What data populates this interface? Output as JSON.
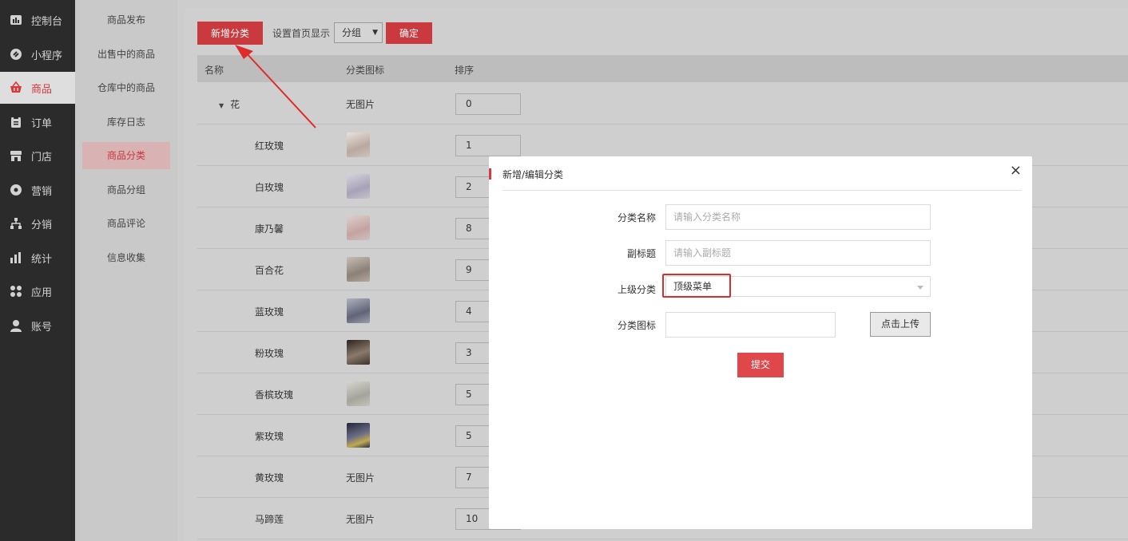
{
  "nav": {
    "items": [
      {
        "label": "控制台",
        "icon": "dashboard-icon"
      },
      {
        "label": "小程序",
        "icon": "link-icon"
      },
      {
        "label": "商品",
        "icon": "basket-icon",
        "active": true
      },
      {
        "label": "订单",
        "icon": "clipboard-icon"
      },
      {
        "label": "门店",
        "icon": "store-icon"
      },
      {
        "label": "营销",
        "icon": "gear-icon"
      },
      {
        "label": "分销",
        "icon": "hierarchy-icon"
      },
      {
        "label": "统计",
        "icon": "bar-chart-icon"
      },
      {
        "label": "应用",
        "icon": "apps-icon"
      },
      {
        "label": "账号",
        "icon": "user-icon"
      }
    ]
  },
  "subnav": {
    "items": [
      {
        "label": "商品发布"
      },
      {
        "label": "出售中的商品"
      },
      {
        "label": "仓库中的商品"
      },
      {
        "label": "库存日志"
      },
      {
        "label": "商品分类",
        "active": true
      },
      {
        "label": "商品分组"
      },
      {
        "label": "商品评论"
      },
      {
        "label": "信息收集"
      }
    ]
  },
  "toolbar": {
    "add_category_label": "新增分类",
    "homepage_display_label": "设置首页显示",
    "display_select_value": "分组",
    "confirm_label": "确定"
  },
  "table": {
    "columns": [
      "名称",
      "分类图标",
      "排序"
    ],
    "rows": [
      {
        "name": "花",
        "icon_text": "无图片",
        "sort": "0",
        "parent": true
      },
      {
        "name": "红玫瑰",
        "icon_text": "",
        "sort": "1",
        "thumb_color": "#cfc6c0"
      },
      {
        "name": "白玫瑰",
        "icon_text": "",
        "sort": "2",
        "thumb_color": "#c4c0cc"
      },
      {
        "name": "康乃馨",
        "icon_text": "",
        "sort": "8",
        "thumb_color": "#cdbbb9"
      },
      {
        "name": "百合花",
        "icon_text": "",
        "sort": "9",
        "thumb_color": "#b5aca4"
      },
      {
        "name": "蓝玫瑰",
        "icon_text": "",
        "sort": "4",
        "thumb_color": "#8e93a3"
      },
      {
        "name": "粉玫瑰",
        "icon_text": "",
        "sort": "3",
        "thumb_color": "#5a4a3d"
      },
      {
        "name": "香槟玫瑰",
        "icon_text": "",
        "sort": "5",
        "thumb_color": "#b9b9b2"
      },
      {
        "name": "紫玫瑰",
        "icon_text": "",
        "sort": "5",
        "thumb_color": "#3b3f52"
      },
      {
        "name": "黄玫瑰",
        "icon_text": "无图片",
        "sort": "7"
      },
      {
        "name": "马蹄莲",
        "icon_text": "无图片",
        "sort": "10"
      }
    ]
  },
  "modal": {
    "title": "新增/编辑分类",
    "close_icon": "×",
    "name_label": "分类名称",
    "name_placeholder": "请输入分类名称",
    "subtitle_label": "副标题",
    "subtitle_placeholder": "请输入副标题",
    "parent_label": "上级分类",
    "parent_value": "顶级菜单",
    "icon_label": "分类图标",
    "upload_label": "点击上传",
    "submit_label": "提交"
  },
  "colors": {
    "accent": "#d8383c",
    "sidebar_bg": "#2b2b2b",
    "annotation": "#e02b2b"
  }
}
